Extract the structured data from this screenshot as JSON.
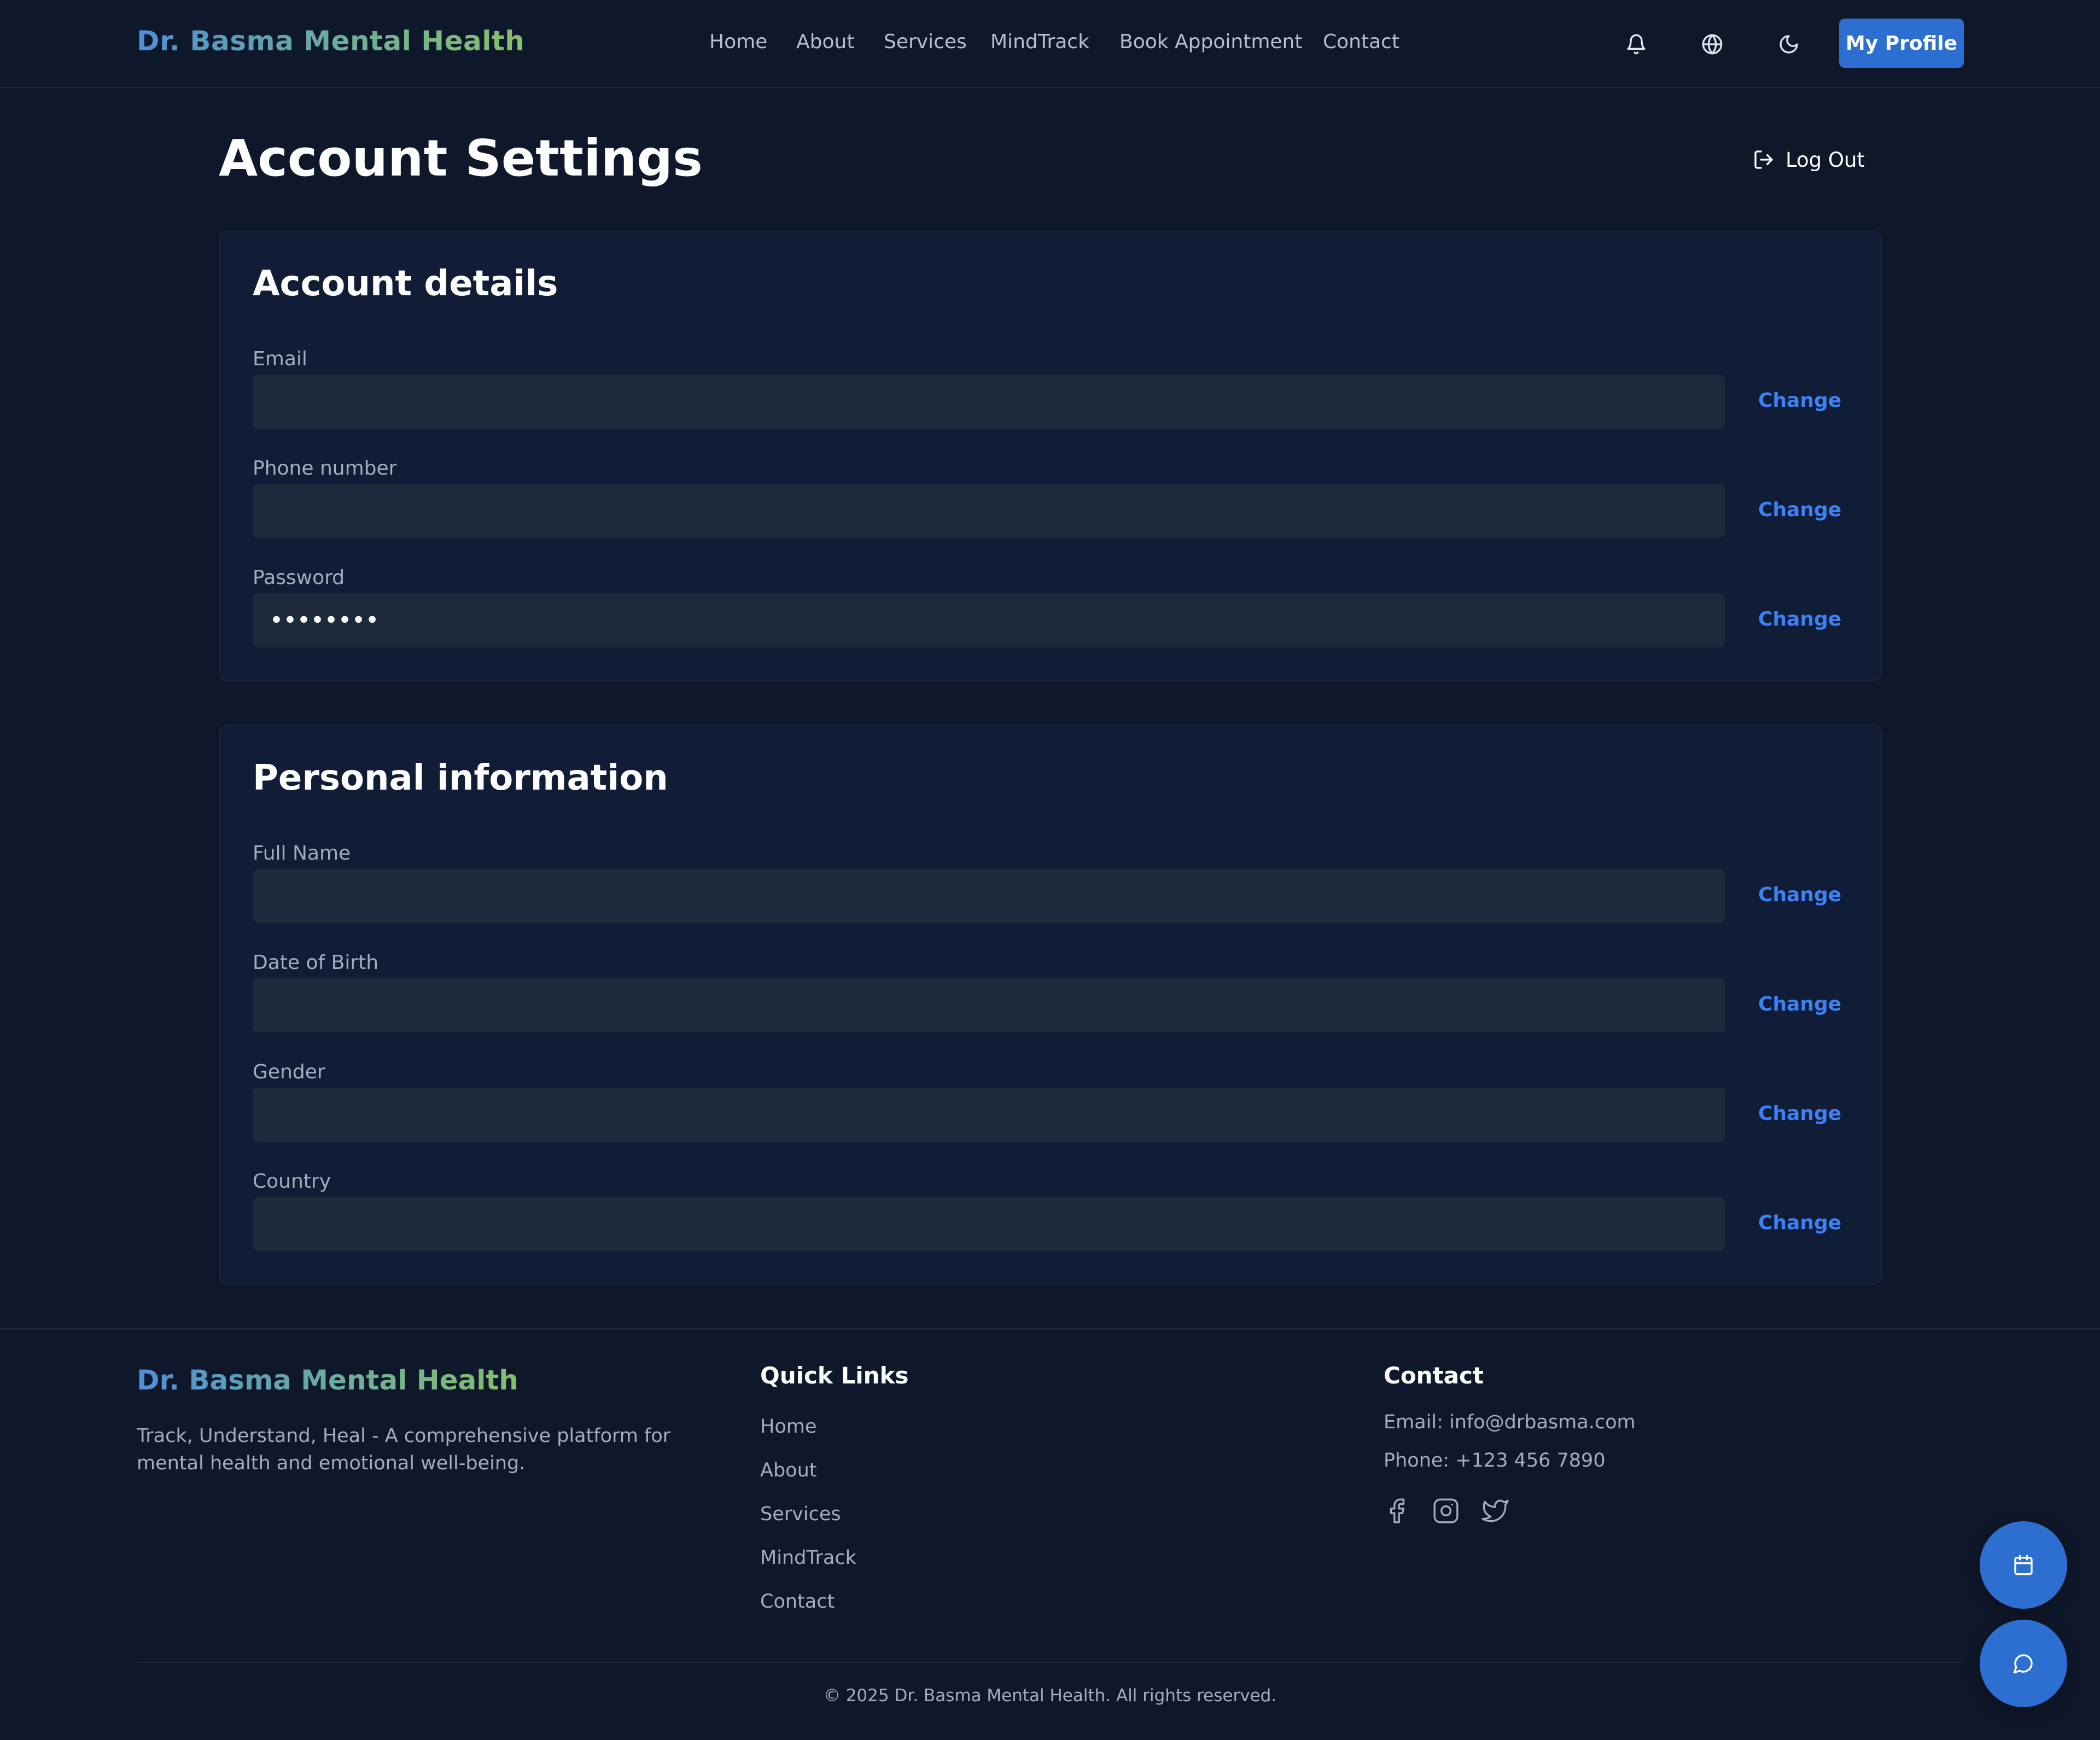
{
  "header": {
    "brand": "Dr. Basma Mental Health",
    "nav": [
      "Home",
      "About",
      "Services",
      "MindTrack",
      "Book Appointment",
      "Contact"
    ],
    "icons": [
      "bell-icon",
      "globe-icon",
      "moon-icon"
    ],
    "profile_label": "My Profile"
  },
  "page": {
    "title": "Account Settings",
    "logout_label": "Log Out"
  },
  "account_details": {
    "title": "Account details",
    "fields": [
      {
        "label": "Email",
        "value": "",
        "action": "Change"
      },
      {
        "label": "Phone number",
        "value": "",
        "action": "Change"
      },
      {
        "label": "Password",
        "value": "••••••••",
        "action": "Change"
      }
    ]
  },
  "personal_information": {
    "title": "Personal information",
    "fields": [
      {
        "label": "Full Name",
        "value": "",
        "action": "Change"
      },
      {
        "label": "Date of Birth",
        "value": "",
        "action": "Change"
      },
      {
        "label": "Gender",
        "value": "",
        "action": "Change"
      },
      {
        "label": "Country",
        "value": "",
        "action": "Change"
      }
    ]
  },
  "footer": {
    "brand": "Dr. Basma Mental Health",
    "tagline": "Track, Understand, Heal - A comprehensive platform for mental health and emotional well-being.",
    "quick_links_title": "Quick Links",
    "quick_links": [
      "Home",
      "About",
      "Services",
      "MindTrack",
      "Contact"
    ],
    "contact_title": "Contact",
    "email_line": "Email: info@drbasma.com",
    "phone_line": "Phone: +123 456 7890",
    "social_icons": [
      "facebook-icon",
      "instagram-icon",
      "twitter-icon"
    ],
    "copyright": "© 2025 Dr. Basma Mental Health. All rights reserved."
  },
  "floating": {
    "icons": [
      "calendar-icon",
      "chat-icon"
    ]
  },
  "colors": {
    "background": "#0f172a",
    "card": "#111c36",
    "input": "#1e293b",
    "accent": "#2d6fd1",
    "link": "#3b82f6"
  }
}
